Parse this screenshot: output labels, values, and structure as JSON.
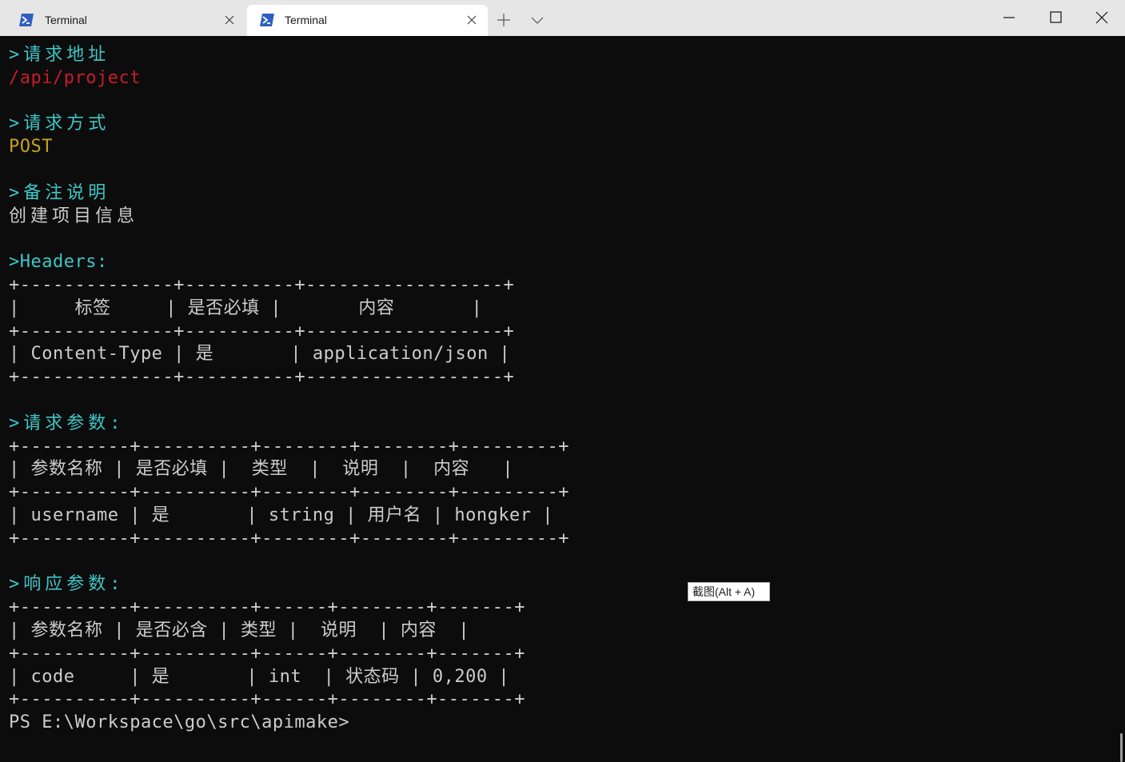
{
  "titlebar": {
    "tabs": [
      {
        "label": "Terminal",
        "icon": "powershell-icon",
        "active": false
      },
      {
        "label": "Terminal",
        "icon": "powershell-icon",
        "active": true
      }
    ]
  },
  "terminal": {
    "request_url_heading": ">请求地址",
    "request_url": "/api/project",
    "request_method_heading": ">请求方式",
    "request_method": "POST",
    "remark_heading": ">备注说明",
    "remark": "创建项目信息",
    "headers_heading": ">Headers:",
    "headers_table": [
      "+--------------+----------+------------------+",
      "|     标签     | 是否必填 |       内容       |",
      "+--------------+----------+------------------+",
      "| Content-Type | 是       | application/json |",
      "+--------------+----------+------------------+"
    ],
    "request_params_heading": ">请求参数:",
    "request_params_table": [
      "+----------+----------+--------+--------+---------+",
      "| 参数名称 | 是否必填 |  类型  |  说明  |  内容   |",
      "+----------+----------+--------+--------+---------+",
      "| username | 是       | string | 用户名 | hongker |",
      "+----------+----------+--------+--------+---------+"
    ],
    "response_params_heading": ">响应参数:",
    "response_params_table": [
      "+----------+----------+------+--------+-------+",
      "| 参数名称 | 是否必含 | 类型 |  说明  | 内容  |",
      "+----------+----------+------+--------+-------+",
      "| code     | 是       | int  | 状态码 | 0,200 |",
      "+----------+----------+------+--------+-------+"
    ],
    "prompt": "PS E:\\Workspace\\go\\src\\apimake>"
  },
  "tooltip": {
    "text": "截图(Alt + A)"
  },
  "colors": {
    "heading": "#3fc6c6",
    "url": "#c91b2b",
    "method": "#c6a31c",
    "text": "#cccccc",
    "background": "#0c0c0c"
  }
}
